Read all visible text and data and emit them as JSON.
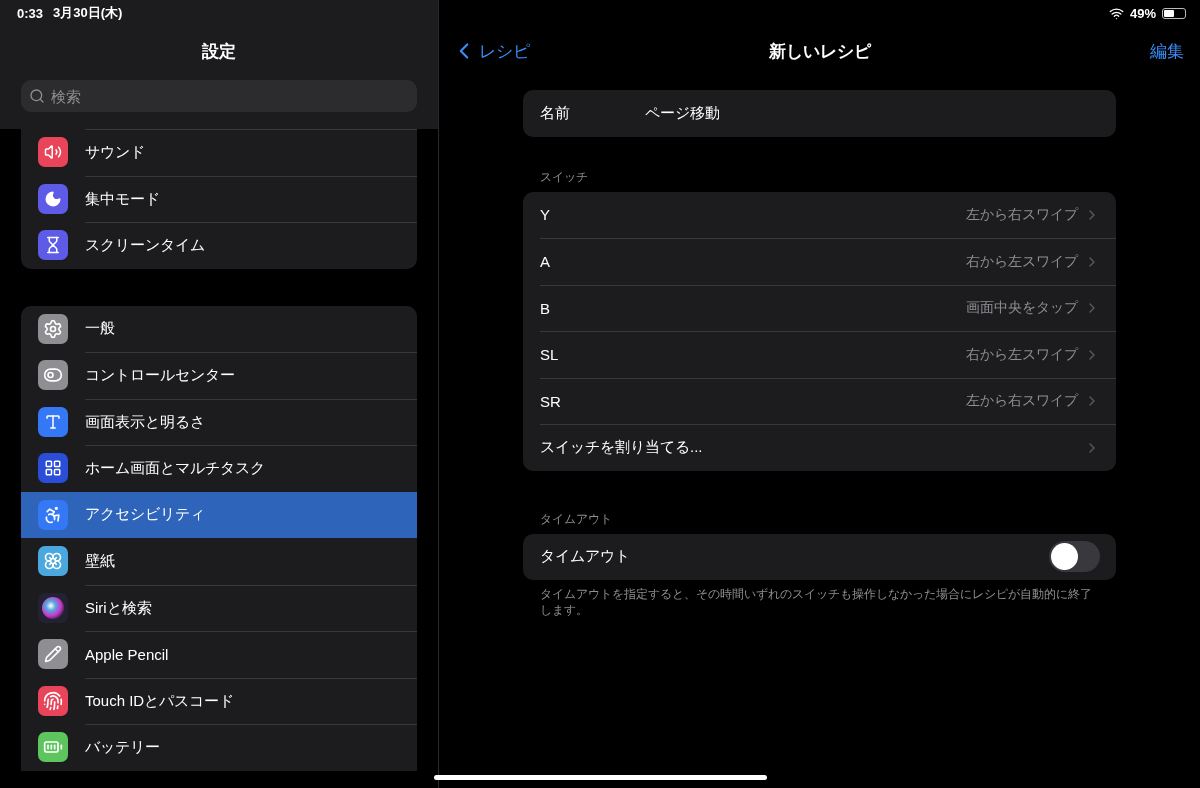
{
  "status_bar": {
    "time": "0:33",
    "date": "3月30日(木)",
    "battery": "49%"
  },
  "sidebar": {
    "title": "設定",
    "search": {
      "placeholder": "検索"
    },
    "groups": [
      [
        {
          "label": "サウンド",
          "color": "#e8455a",
          "selected": false
        },
        {
          "label": "集中モード",
          "color": "#5e5ce6",
          "selected": false
        },
        {
          "label": "スクリーンタイム",
          "color": "#5e5ce6",
          "selected": false
        }
      ],
      [
        {
          "label": "一般",
          "color": "#8e8e93",
          "selected": false
        },
        {
          "label": "コントロールセンター",
          "color": "#8e8e93",
          "selected": false
        },
        {
          "label": "画面表示と明るさ",
          "color": "#3478f6",
          "selected": false
        },
        {
          "label": "ホーム画面とマルチタスク",
          "color": "#2a4ed8",
          "selected": false
        },
        {
          "label": "アクセシビリティ",
          "color": "#3478f6",
          "selected": true
        },
        {
          "label": "壁紙",
          "color": "#4aa8de",
          "selected": false
        },
        {
          "label": "Siriと検索",
          "color": "#222233",
          "selected": false
        },
        {
          "label": "Apple Pencil",
          "color": "#8e8e93",
          "selected": false
        },
        {
          "label": "Touch IDとパスコード",
          "color": "#e8455a",
          "selected": false
        },
        {
          "label": "バッテリー",
          "color": "#5ec45e",
          "selected": false
        }
      ]
    ]
  },
  "detail": {
    "back_label": "レシピ",
    "title": "新しいレシピ",
    "edit_label": "編集",
    "name_row": {
      "label": "名前",
      "value": "ページ移動"
    },
    "switch_section": {
      "header": "スイッチ",
      "rows": [
        {
          "kind": "mapping",
          "label": "Y",
          "value": "左から右スワイプ"
        },
        {
          "kind": "mapping",
          "label": "A",
          "value": "右から左スワイプ"
        },
        {
          "kind": "mapping",
          "label": "B",
          "value": "画面中央をタップ"
        },
        {
          "kind": "mapping",
          "label": "SL",
          "value": "右から左スワイプ"
        },
        {
          "kind": "mapping",
          "label": "SR",
          "value": "左から右スワイプ"
        },
        {
          "kind": "action",
          "label": "スイッチを割り当てる..."
        }
      ]
    },
    "timeout_section": {
      "header": "タイムアウト",
      "label": "タイムアウト",
      "on": false,
      "footer": "タイムアウトを指定すると、その時間いずれのスイッチも操作しなかった場合にレシピが自動的に終了します。"
    }
  }
}
